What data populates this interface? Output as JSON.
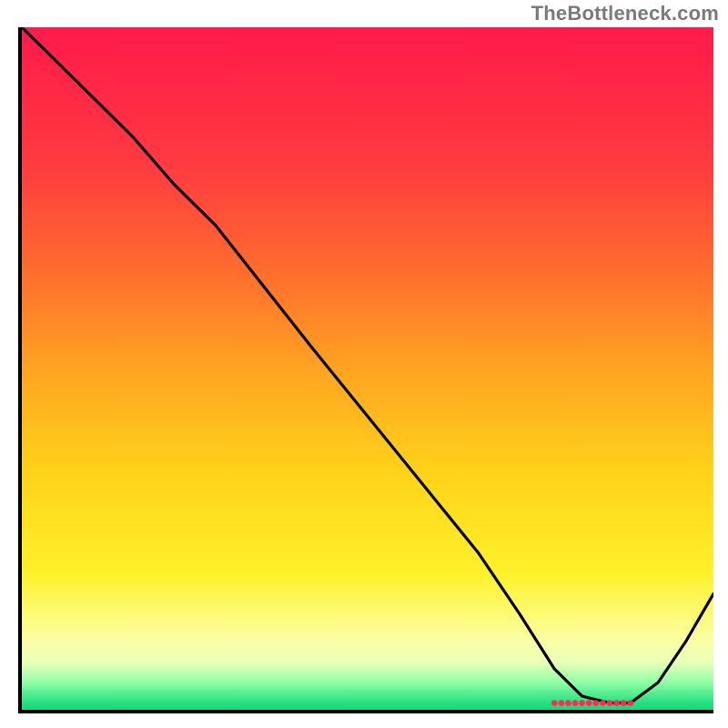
{
  "watermark": "TheBottleneck.com",
  "chart_data": {
    "type": "line",
    "title": "",
    "xlabel": "",
    "ylabel": "",
    "xlim": [
      0,
      100
    ],
    "ylim": [
      0,
      100
    ],
    "grid": false,
    "legend": false,
    "description": "Bottleneck-percentage curve over a red-yellow-green gradient background. Values approach 0 (green band) around the optimum.",
    "series": [
      {
        "name": "bottleneck-curve",
        "color": "#000000",
        "x": [
          0,
          8,
          16,
          22,
          28,
          35,
          42,
          50,
          58,
          66,
          72,
          77,
          81,
          85,
          88,
          92,
          96,
          100
        ],
        "y": [
          100,
          92,
          84,
          77,
          71,
          62,
          53,
          43,
          33,
          23,
          14,
          6,
          2,
          1,
          1,
          4,
          10,
          17
        ]
      }
    ],
    "optimum_band": {
      "x_start": 77,
      "x_end": 88,
      "y": 1,
      "color": "#ff2a55"
    }
  }
}
